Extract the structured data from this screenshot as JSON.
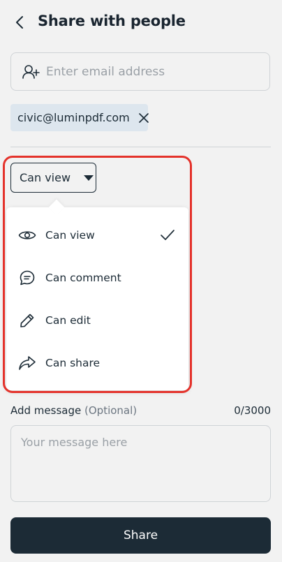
{
  "header": {
    "title": "Share with people"
  },
  "email_input": {
    "placeholder": "Enter email address"
  },
  "chip": {
    "email": "civic@luminpdf.com"
  },
  "permission_select": {
    "selected": "Can view"
  },
  "menu": {
    "items": [
      {
        "label": "Can view",
        "icon": "eye-icon",
        "checked": true
      },
      {
        "label": "Can comment",
        "icon": "comment-icon",
        "checked": false
      },
      {
        "label": "Can edit",
        "icon": "pencil-icon",
        "checked": false
      },
      {
        "label": "Can share",
        "icon": "share-arrow-icon",
        "checked": false
      }
    ]
  },
  "message": {
    "label": "Add message",
    "optional": "(Optional)",
    "count": "0/3000",
    "placeholder": "Your message here"
  },
  "share_button": {
    "label": "Share"
  },
  "colors": {
    "primary": "#1c2b36",
    "highlight": "#e4322b",
    "chip_bg": "#dde6ee"
  }
}
